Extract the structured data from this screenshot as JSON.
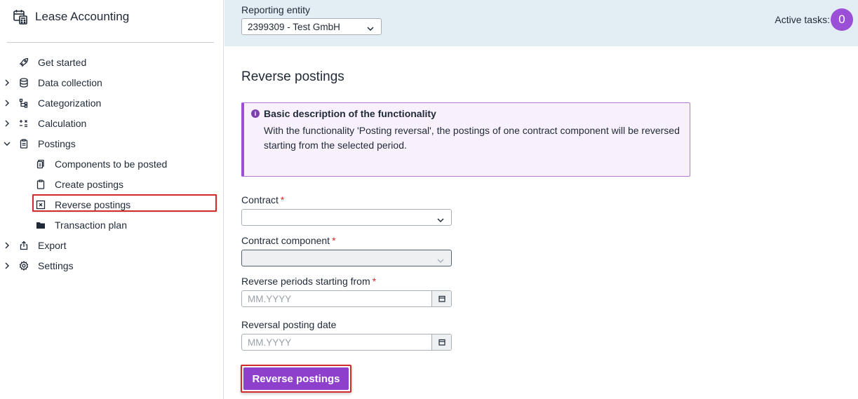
{
  "app": {
    "title": "Lease Accounting",
    "brand_icon": "calendar-calculator-icon"
  },
  "sidebar": {
    "items": [
      {
        "label": "Get started",
        "icon": "rocket-icon",
        "expandable": false
      },
      {
        "label": "Data collection",
        "icon": "database-icon",
        "expandable": true
      },
      {
        "label": "Categorization",
        "icon": "hierarchy-icon",
        "expandable": true
      },
      {
        "label": "Calculation",
        "icon": "calculator-symbols-icon",
        "expandable": true
      },
      {
        "label": "Postings",
        "icon": "clipboard-icon",
        "expandable": true,
        "expanded": true
      },
      {
        "label": "Components to be posted",
        "icon": "document-stack-icon",
        "sub": true
      },
      {
        "label": "Create postings",
        "icon": "clipboard-outline-icon",
        "sub": true
      },
      {
        "label": "Reverse postings",
        "icon": "x-box-icon",
        "sub": true,
        "active": true
      },
      {
        "label": "Transaction plan",
        "icon": "folder-icon",
        "sub": true
      },
      {
        "label": "Export",
        "icon": "export-icon",
        "expandable": true
      },
      {
        "label": "Settings",
        "icon": "gear-icon",
        "expandable": true
      }
    ]
  },
  "header": {
    "entity_label": "Reporting entity",
    "entity_value": "2399309 - Test GmbH",
    "tasks_label": "Active tasks:",
    "tasks_count": "0"
  },
  "main": {
    "title": "Reverse postings",
    "info": {
      "title": "Basic description of the functionality",
      "text": "With the functionality 'Posting reversal', the postings of one contract component will be reversed starting from the selected period."
    },
    "fields": {
      "contract_label": "Contract",
      "component_label": "Contract component",
      "periods_label": "Reverse periods starting from",
      "date_label": "Reversal posting date",
      "required_mark": "*",
      "date_placeholder": "MM.YYYY"
    },
    "submit_label": "Reverse postings"
  },
  "colors": {
    "accent": "#8e3fcc",
    "header_bg": "#e2eef3",
    "info_bg": "#f8f1fc",
    "required": "#d42a2a"
  }
}
